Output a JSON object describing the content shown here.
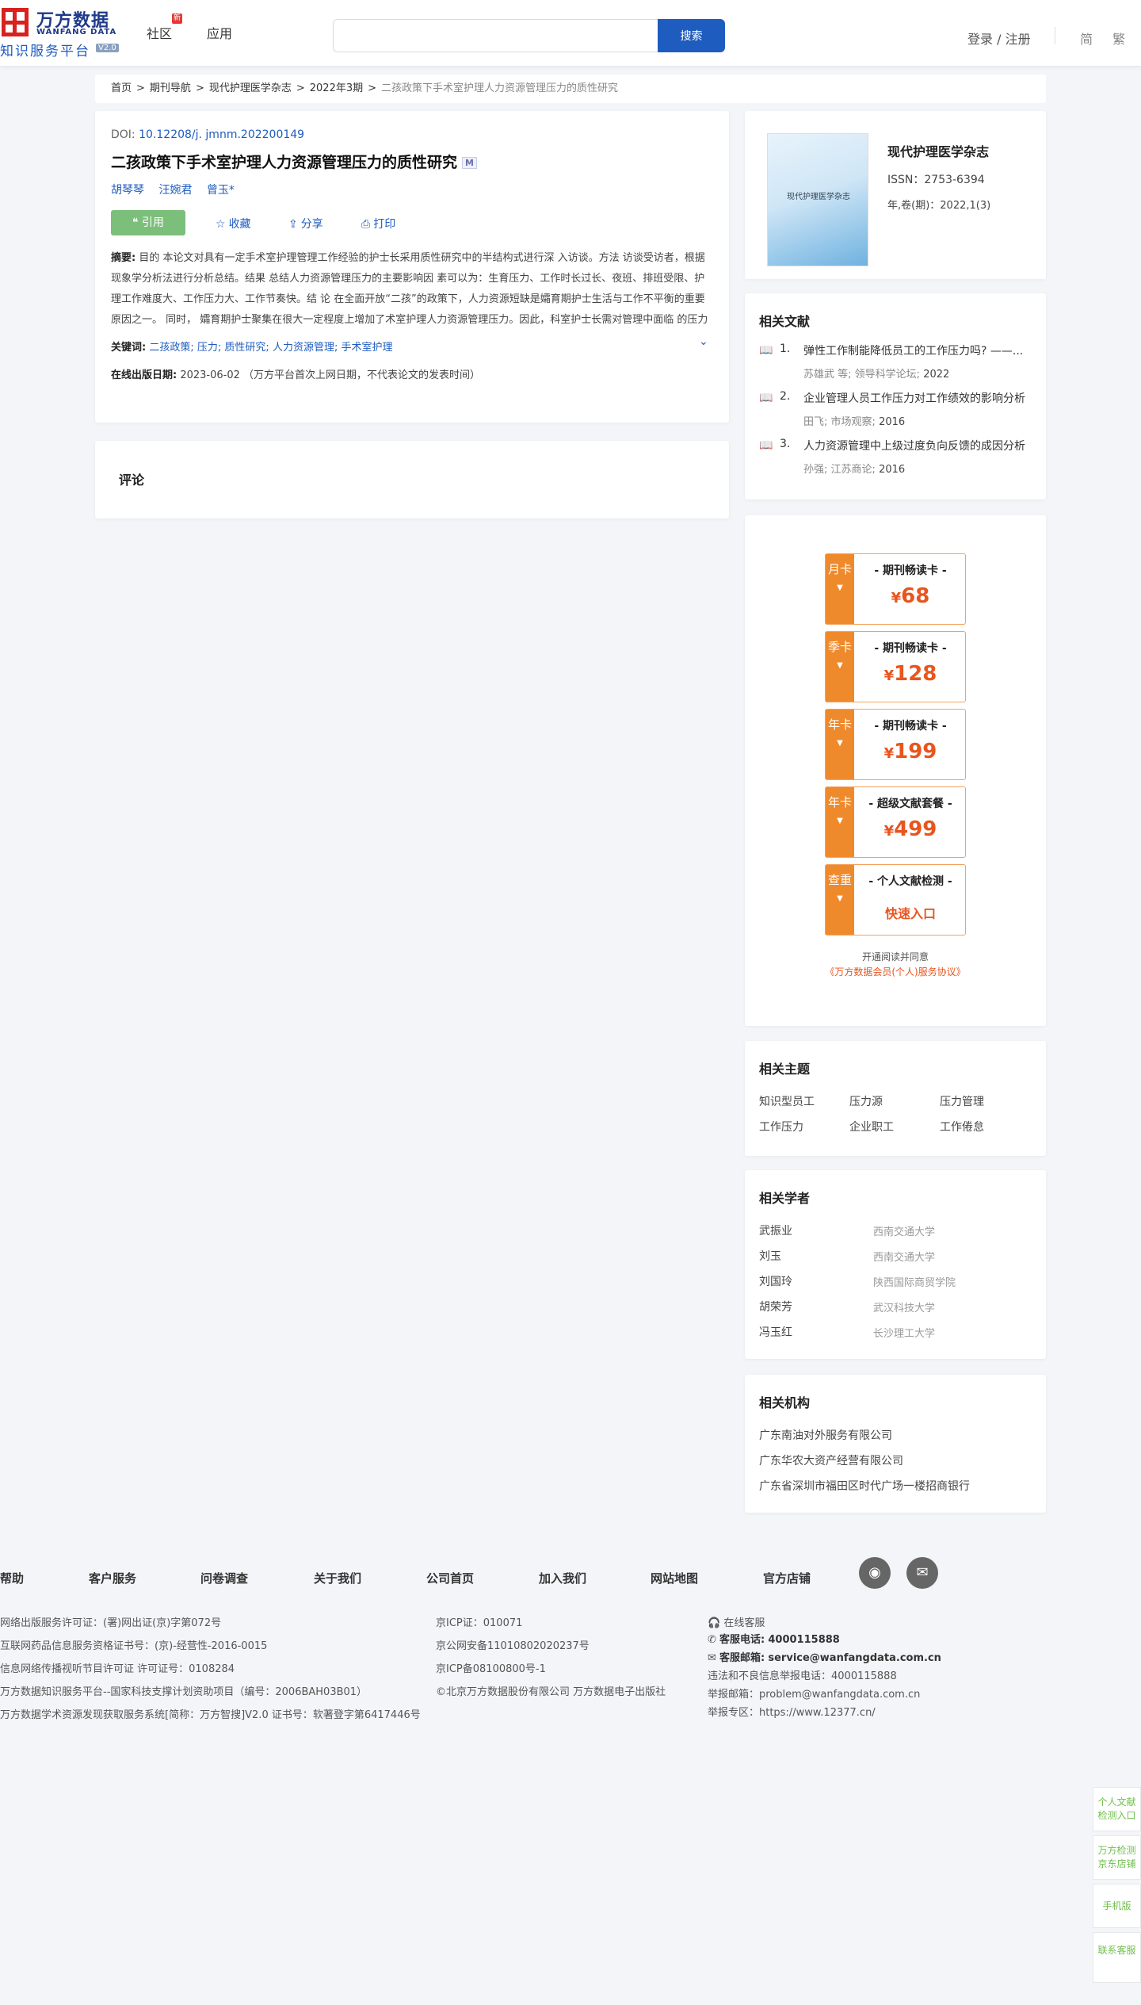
{
  "header": {
    "logo_cn": "万方数据",
    "logo_en": "WANFANG DATA",
    "logo_sub": "知识服务平台",
    "logo_version": "V2.0",
    "nav": [
      {
        "label": "社区",
        "badge": "新"
      },
      {
        "label": "应用"
      }
    ],
    "search_placeholder": "",
    "search_button": "搜索",
    "login": "登录 / 注册",
    "lang_simplified": "简",
    "lang_traditional": "繁"
  },
  "breadcrumb": [
    "首页",
    "期刊导航",
    "现代护理医学杂志",
    "2022年3期",
    "二孩政策下手术室护理人力资源管理压力的质性研究"
  ],
  "breadcrumb_sep": ">",
  "article": {
    "doi_label": "DOI:",
    "doi": "10.12208/j. jmnm.202200149",
    "title": "二孩政策下手术室护理人力资源管理压力的质性研究",
    "title_badge": "M",
    "authors": [
      "胡琴琴",
      "汪婉君",
      "曾玉*"
    ],
    "actions": {
      "cite": "引用",
      "favorite": "收藏",
      "share": "分享",
      "print": "打印"
    },
    "abstract_label": "摘要:",
    "abstract": "目的 本论文对具有一定手术室护理管理工作经验的护士长采用质性研究中的半结构式进行深 入访谈。方法 访谈受访者，根据现象学分析法进行分析总结。结果 总结人力资源管理压力的主要影响因 素可以为：生育压力、工作时长过长、夜班、排班受限、护理工作难度大、工作压力大、工作节奏快。结 论 在全面开放“二孩”的政策下，人力资源短缺是孀育期护士生活与工作不平衡的重要原因之一。 同时， 孀育期护士聚集在很大一定程度上增加了术室护理人力资源管理压力。因此，科室护士长需对管理中面临 的压力的挑战有预见性，提前调查、了解本科室护理人员孀育情况，有计划完善机动护...",
    "keywords_label": "关键词:",
    "keywords": [
      "二孩政策;",
      "压力;",
      "质性研究;",
      "人力资源管理;",
      "手术室护理"
    ],
    "pubdate_label": "在线出版日期:",
    "pubdate": "2023-06-02",
    "pubdate_note": "（万方平台首次上网日期，不代表论文的发表时间）"
  },
  "comment_title": "评论",
  "journal": {
    "cover_title": "现代护理医学杂志",
    "name": "现代护理医学杂志",
    "issn": "ISSN：2753-6394",
    "volume": "年,卷(期)：2022,1(3)"
  },
  "related_docs": {
    "title": "相关文献",
    "items": [
      {
        "num": "1.",
        "title": "弹性工作制能降低员工的工作压力吗? ——...",
        "authors": "苏雄武  等;",
        "source": "领导科学论坛;",
        "year": "2022"
      },
      {
        "num": "2.",
        "title": "企业管理人员工作压力对工作绩效的影响分析",
        "authors": "田飞;",
        "source": "市场观察;",
        "year": "2016"
      },
      {
        "num": "3.",
        "title": "人力资源管理中上级过度负向反馈的成因分析",
        "authors": "孙强;",
        "source": "江苏商论;",
        "year": "2016"
      }
    ]
  },
  "promo": {
    "cards": [
      {
        "tab": "月卡",
        "title": "- 期刊畅读卡 -",
        "currency": "¥",
        "price": "68"
      },
      {
        "tab": "季卡",
        "title": "- 期刊畅读卡 -",
        "currency": "¥",
        "price": "128"
      },
      {
        "tab": "年卡",
        "title": "- 期刊畅读卡 -",
        "currency": "¥",
        "price": "199"
      },
      {
        "tab": "年卡",
        "title": "- 超级文献套餐 -",
        "currency": "¥",
        "price": "499"
      },
      {
        "tab": "查重",
        "title": "- 个人文献检测 -",
        "link": "快速入口"
      }
    ],
    "agreement_prefix": "开通阅读并同意",
    "agreement_link": "《万方数据会员(个人)服务协议》"
  },
  "topics": {
    "title": "相关主题",
    "items": [
      "知识型员工",
      "压力源",
      "压力管理",
      "工作压力",
      "企业职工",
      "工作倦怠"
    ]
  },
  "scholars": {
    "title": "相关学者",
    "items": [
      {
        "name": "武振业",
        "org": "西南交通大学"
      },
      {
        "name": "刘玉",
        "org": "西南交通大学"
      },
      {
        "name": "刘国玲",
        "org": "陕西国际商贸学院"
      },
      {
        "name": "胡荣芳",
        "org": "武汉科技大学"
      },
      {
        "name": "冯玉红",
        "org": "长沙理工大学"
      }
    ]
  },
  "orgs": {
    "title": "相关机构",
    "items": [
      "广东南油对外服务有限公司",
      "广东华农大资产经营有限公司",
      "广东省深圳市福田区时代广场一楼招商银行"
    ]
  },
  "footer": {
    "links": [
      "帮助",
      "客户服务",
      "问卷调查",
      "关于我们",
      "公司首页",
      "加入我们",
      "网站地图",
      "官方店铺"
    ],
    "licenses_left": [
      "网络出版服务许可证：(署)网出证(京)字第072号",
      "互联网药品信息服务资格证书号：(京)-经营性-2016-0015",
      "信息网络传播视听节目许可证 许可证号：0108284",
      "万方数据知识服务平台--国家科技支撑计划资助项目（编号：2006BAH03B01）",
      "万方数据学术资源发现获取服务系统[简称：万方智搜]V2.0 证书号：软著登字第6417446号"
    ],
    "licenses_mid": [
      "京ICP证：010071",
      "京公网安备11010802020237号",
      "京ICP备08100800号-1",
      "©北京万方数据股份有限公司 万方数据电子出版社"
    ],
    "contact": {
      "online": "在线客服",
      "phone_label": "客服电话:",
      "phone": "4000115888",
      "email_label": "客服邮箱:",
      "email": "service@wanfangdata.com.cn",
      "report_phone": "违法和不良信息举报电话：4000115888",
      "report_email": "举报邮箱：problem@wanfangdata.com.cn",
      "report_zone": "举报专区：https://www.12377.cn/"
    }
  },
  "side_tools": [
    "个人文献检测入口",
    "万方检测京东店铺",
    "手机版",
    "联系客服"
  ]
}
